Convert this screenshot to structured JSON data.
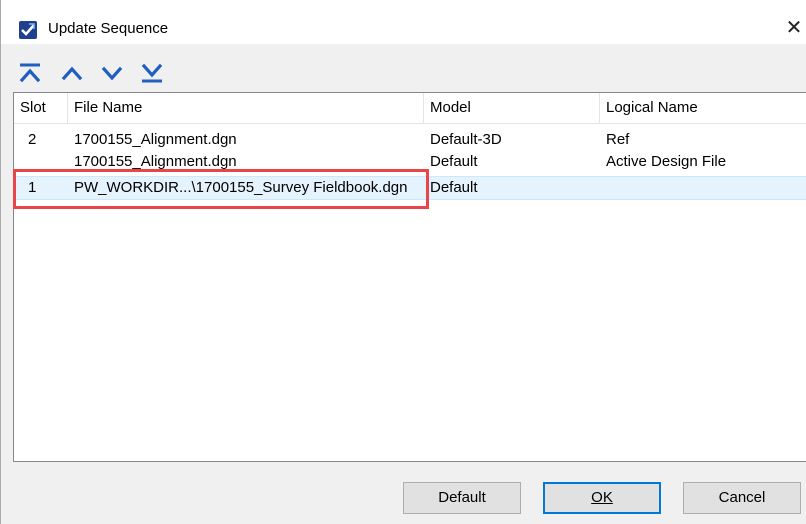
{
  "window": {
    "title": "Update Sequence",
    "close_glyph": "✕"
  },
  "toolbar": {
    "buttons": [
      {
        "name": "move-to-top",
        "icon": "move-to-top-icon"
      },
      {
        "name": "move-up",
        "icon": "chevron-up-icon"
      },
      {
        "name": "move-down",
        "icon": "chevron-down-icon"
      },
      {
        "name": "move-to-bottom",
        "icon": "move-to-bottom-icon"
      }
    ],
    "icon_color": "#1f5fbf"
  },
  "list": {
    "columns": [
      "Slot",
      "File Name",
      "Model",
      "Logical Name"
    ],
    "rows": [
      {
        "slot": "2",
        "file": "1700155_Alignment.dgn",
        "model": "Default-3D",
        "logical": "Ref"
      },
      {
        "slot": "",
        "file": "1700155_Alignment.dgn",
        "model": "Default",
        "logical": "Active Design File"
      },
      {
        "slot": "1",
        "file": "PW_WORKDIR...\\1700155_Survey Fieldbook.dgn",
        "model": "Default",
        "logical": ""
      }
    ],
    "selected_row": 2,
    "highlight_color": "#e8474a"
  },
  "footer": {
    "default_label": "Default",
    "ok_label": "OK",
    "cancel_label": "Cancel"
  }
}
